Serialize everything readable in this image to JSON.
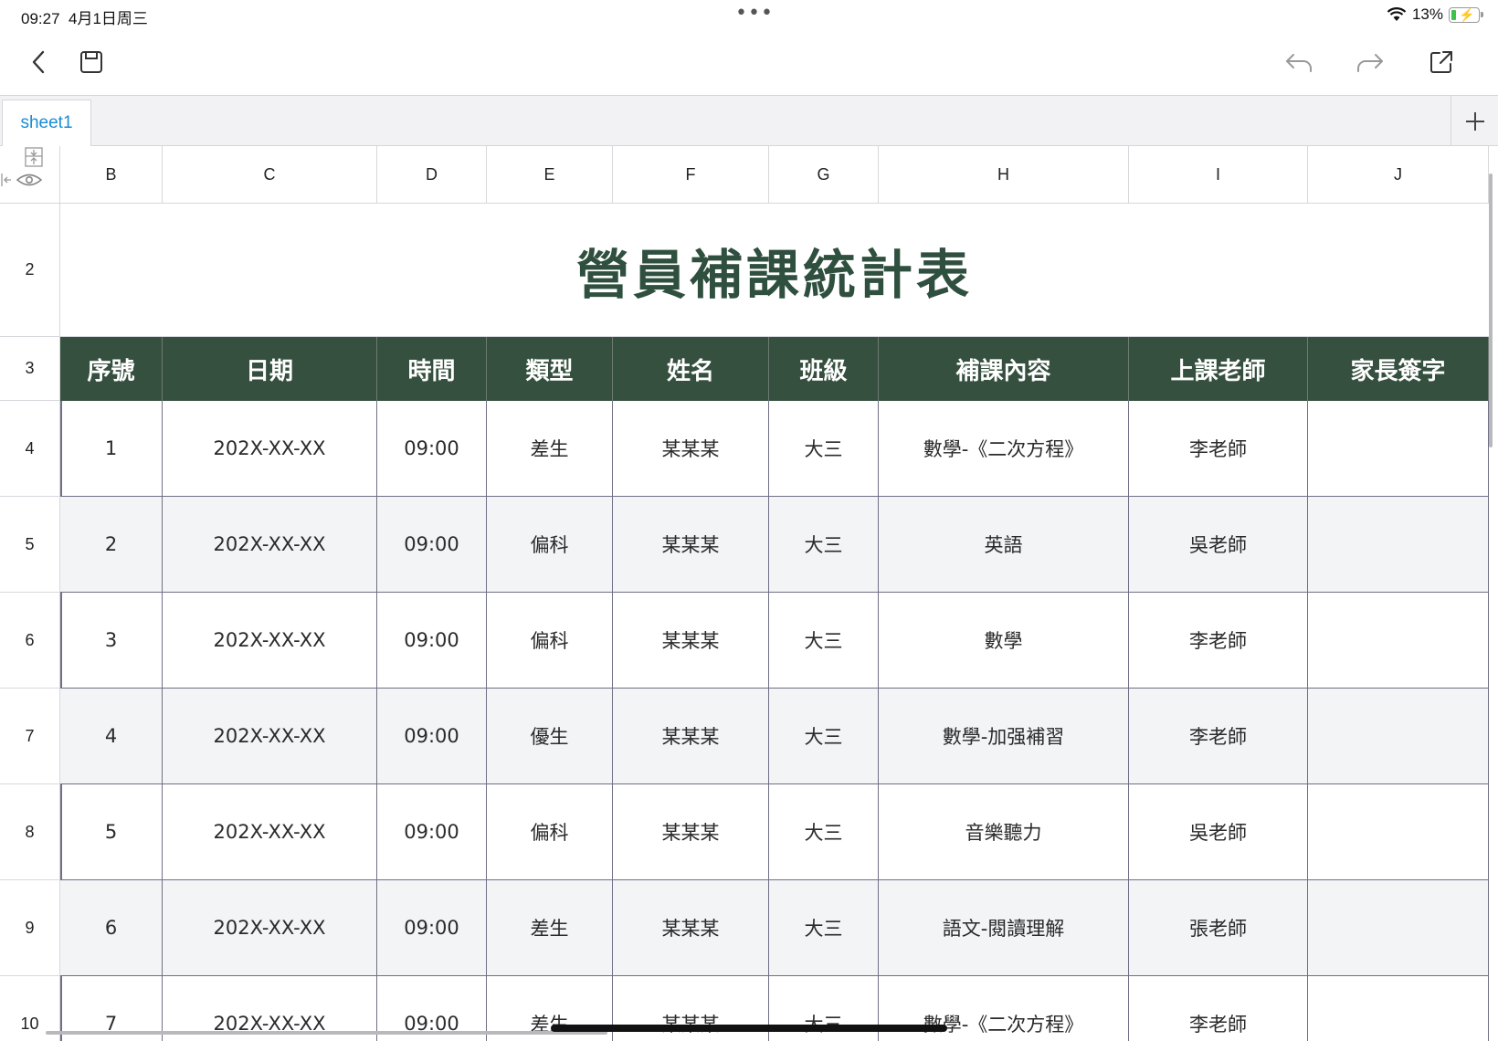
{
  "status_bar": {
    "time": "09:27",
    "date": "4月1日周三",
    "battery": "13%"
  },
  "toolbar": {
    "back_icon": "chevron-left-icon",
    "save_icon": "save-icon",
    "undo_icon": "undo-icon",
    "redo_icon": "redo-icon",
    "share_icon": "share-icon"
  },
  "sheets": {
    "active_tab": "sheet1",
    "add_label": "+"
  },
  "columns": [
    "B",
    "C",
    "D",
    "E",
    "F",
    "G",
    "H",
    "I",
    "J"
  ],
  "rows": [
    "2",
    "3",
    "4",
    "5",
    "6",
    "7",
    "8",
    "9",
    "10"
  ],
  "spreadsheet": {
    "title": "營員補課統計表",
    "headers": [
      "序號",
      "日期",
      "時間",
      "類型",
      "姓名",
      "班級",
      "補課內容",
      "上課老師",
      "家長簽字"
    ],
    "data": [
      [
        "1",
        "202X-XX-XX",
        "09:00",
        "差生",
        "某某某",
        "大三",
        "數學-《二次方程》",
        "李老師",
        ""
      ],
      [
        "2",
        "202X-XX-XX",
        "09:00",
        "偏科",
        "某某某",
        "大三",
        "英語",
        "吳老師",
        ""
      ],
      [
        "3",
        "202X-XX-XX",
        "09:00",
        "偏科",
        "某某某",
        "大三",
        "數學",
        "李老師",
        ""
      ],
      [
        "4",
        "202X-XX-XX",
        "09:00",
        "優生",
        "某某某",
        "大三",
        "數學-加强補習",
        "李老師",
        ""
      ],
      [
        "5",
        "202X-XX-XX",
        "09:00",
        "偏科",
        "某某某",
        "大三",
        "音樂聽力",
        "吳老師",
        ""
      ],
      [
        "6",
        "202X-XX-XX",
        "09:00",
        "差生",
        "某某某",
        "大三",
        "語文-閱讀理解",
        "張老師",
        ""
      ],
      [
        "7",
        "202X-XX-XX",
        "09:00",
        "差生",
        "某某某",
        "大三",
        "數學-《二次方程》",
        "李老師",
        ""
      ]
    ]
  },
  "colors": {
    "header_bg": "#35503f",
    "title_color": "#2f4f3f",
    "tab_text": "#1a8cd8",
    "alt_row": "#f3f4f6"
  }
}
